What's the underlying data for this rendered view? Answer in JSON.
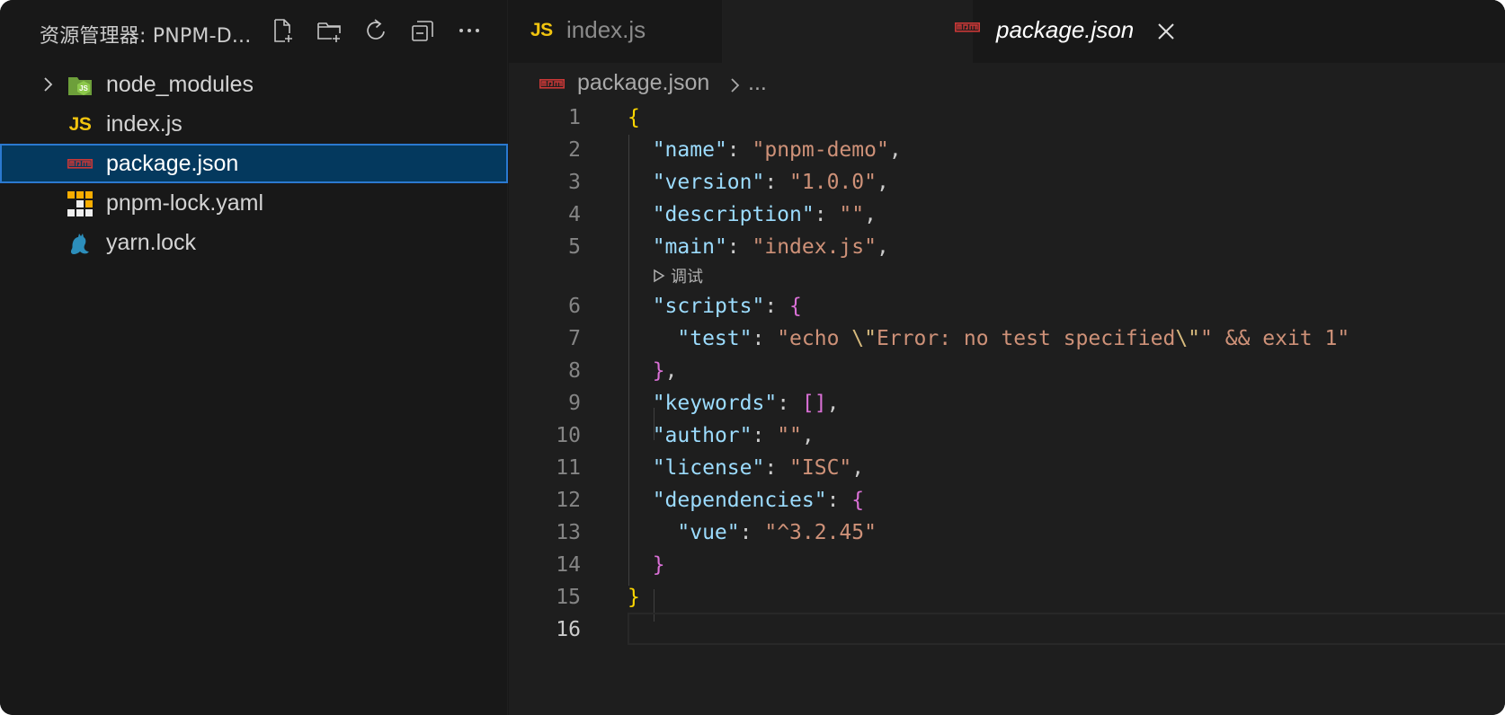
{
  "sidebar": {
    "title": "资源管理器: PNPM-D...",
    "actions": [
      {
        "name": "new-file-icon"
      },
      {
        "name": "new-folder-icon"
      },
      {
        "name": "refresh-icon"
      },
      {
        "name": "collapse-all-icon"
      },
      {
        "name": "more-icon"
      }
    ],
    "items": [
      {
        "label": "node_modules",
        "icon": "nodejs-folder-icon",
        "folder": true
      },
      {
        "label": "index.js",
        "icon": "javascript-file-icon",
        "badge": "JS"
      },
      {
        "label": "package.json",
        "icon": "npm-file-icon",
        "selected": true
      },
      {
        "label": "pnpm-lock.yaml",
        "icon": "pnpm-file-icon"
      },
      {
        "label": "yarn.lock",
        "icon": "yarn-cat-icon"
      }
    ]
  },
  "tabs": [
    {
      "label": "index.js",
      "badge": "JS",
      "active": false
    },
    {
      "label": "package.json",
      "active": true
    }
  ],
  "breadcrumb": {
    "file": "package.json",
    "more": "..."
  },
  "codelens": {
    "label": "调试"
  },
  "colors": {
    "background": "#181818",
    "editor": "#1e1e1e",
    "selection": "#04395e",
    "selection_border": "#2b79d0",
    "json_key": "#9cdcfe",
    "json_string": "#ce9178",
    "bracket_level1": "#ffd700",
    "bracket_level2": "#da70d6",
    "js_badge": "#f1c40f",
    "npm_red": "#cb3837"
  },
  "code": {
    "line_numbers": [
      "1",
      "2",
      "3",
      "4",
      "5",
      "6",
      "7",
      "8",
      "9",
      "10",
      "11",
      "12",
      "13",
      "14",
      "15",
      "16"
    ],
    "name_key": "\"name\"",
    "name_val": "\"pnpm-demo\"",
    "version_key": "\"version\"",
    "version_val": "\"1.0.0\"",
    "description_key": "\"description\"",
    "description_val": "\"\"",
    "main_key": "\"main\"",
    "main_val": "\"index.js\"",
    "scripts_key": "\"scripts\"",
    "test_key": "\"test\"",
    "test_val_1": "\"echo ",
    "test_esc_1": "\\\"",
    "test_val_2": "Error: no test specified",
    "test_esc_2": "\\\"",
    "test_val_3": "\" && exit 1\"",
    "keywords_key": "\"keywords\"",
    "author_key": "\"author\"",
    "author_val": "\"\"",
    "license_key": "\"license\"",
    "license_val": "\"ISC\"",
    "dependencies_key": "\"dependencies\"",
    "vue_key": "\"vue\"",
    "vue_val": "\"^3.2.45\""
  }
}
